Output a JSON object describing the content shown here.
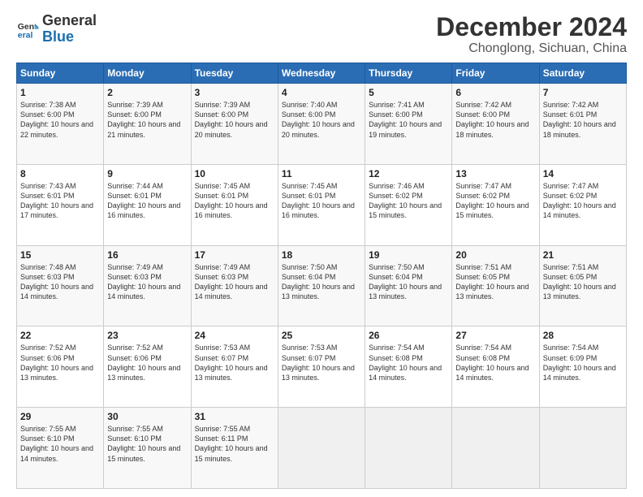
{
  "logo": {
    "text_general": "General",
    "text_blue": "Blue"
  },
  "header": {
    "month": "December 2024",
    "location": "Chonglong, Sichuan, China"
  },
  "days_of_week": [
    "Sunday",
    "Monday",
    "Tuesday",
    "Wednesday",
    "Thursday",
    "Friday",
    "Saturday"
  ],
  "weeks": [
    [
      {
        "day": "1",
        "sunrise": "Sunrise: 7:38 AM",
        "sunset": "Sunset: 6:00 PM",
        "daylight": "Daylight: 10 hours and 22 minutes."
      },
      {
        "day": "2",
        "sunrise": "Sunrise: 7:39 AM",
        "sunset": "Sunset: 6:00 PM",
        "daylight": "Daylight: 10 hours and 21 minutes."
      },
      {
        "day": "3",
        "sunrise": "Sunrise: 7:39 AM",
        "sunset": "Sunset: 6:00 PM",
        "daylight": "Daylight: 10 hours and 20 minutes."
      },
      {
        "day": "4",
        "sunrise": "Sunrise: 7:40 AM",
        "sunset": "Sunset: 6:00 PM",
        "daylight": "Daylight: 10 hours and 20 minutes."
      },
      {
        "day": "5",
        "sunrise": "Sunrise: 7:41 AM",
        "sunset": "Sunset: 6:00 PM",
        "daylight": "Daylight: 10 hours and 19 minutes."
      },
      {
        "day": "6",
        "sunrise": "Sunrise: 7:42 AM",
        "sunset": "Sunset: 6:00 PM",
        "daylight": "Daylight: 10 hours and 18 minutes."
      },
      {
        "day": "7",
        "sunrise": "Sunrise: 7:42 AM",
        "sunset": "Sunset: 6:01 PM",
        "daylight": "Daylight: 10 hours and 18 minutes."
      }
    ],
    [
      {
        "day": "8",
        "sunrise": "Sunrise: 7:43 AM",
        "sunset": "Sunset: 6:01 PM",
        "daylight": "Daylight: 10 hours and 17 minutes."
      },
      {
        "day": "9",
        "sunrise": "Sunrise: 7:44 AM",
        "sunset": "Sunset: 6:01 PM",
        "daylight": "Daylight: 10 hours and 16 minutes."
      },
      {
        "day": "10",
        "sunrise": "Sunrise: 7:45 AM",
        "sunset": "Sunset: 6:01 PM",
        "daylight": "Daylight: 10 hours and 16 minutes."
      },
      {
        "day": "11",
        "sunrise": "Sunrise: 7:45 AM",
        "sunset": "Sunset: 6:01 PM",
        "daylight": "Daylight: 10 hours and 16 minutes."
      },
      {
        "day": "12",
        "sunrise": "Sunrise: 7:46 AM",
        "sunset": "Sunset: 6:02 PM",
        "daylight": "Daylight: 10 hours and 15 minutes."
      },
      {
        "day": "13",
        "sunrise": "Sunrise: 7:47 AM",
        "sunset": "Sunset: 6:02 PM",
        "daylight": "Daylight: 10 hours and 15 minutes."
      },
      {
        "day": "14",
        "sunrise": "Sunrise: 7:47 AM",
        "sunset": "Sunset: 6:02 PM",
        "daylight": "Daylight: 10 hours and 14 minutes."
      }
    ],
    [
      {
        "day": "15",
        "sunrise": "Sunrise: 7:48 AM",
        "sunset": "Sunset: 6:03 PM",
        "daylight": "Daylight: 10 hours and 14 minutes."
      },
      {
        "day": "16",
        "sunrise": "Sunrise: 7:49 AM",
        "sunset": "Sunset: 6:03 PM",
        "daylight": "Daylight: 10 hours and 14 minutes."
      },
      {
        "day": "17",
        "sunrise": "Sunrise: 7:49 AM",
        "sunset": "Sunset: 6:03 PM",
        "daylight": "Daylight: 10 hours and 14 minutes."
      },
      {
        "day": "18",
        "sunrise": "Sunrise: 7:50 AM",
        "sunset": "Sunset: 6:04 PM",
        "daylight": "Daylight: 10 hours and 13 minutes."
      },
      {
        "day": "19",
        "sunrise": "Sunrise: 7:50 AM",
        "sunset": "Sunset: 6:04 PM",
        "daylight": "Daylight: 10 hours and 13 minutes."
      },
      {
        "day": "20",
        "sunrise": "Sunrise: 7:51 AM",
        "sunset": "Sunset: 6:05 PM",
        "daylight": "Daylight: 10 hours and 13 minutes."
      },
      {
        "day": "21",
        "sunrise": "Sunrise: 7:51 AM",
        "sunset": "Sunset: 6:05 PM",
        "daylight": "Daylight: 10 hours and 13 minutes."
      }
    ],
    [
      {
        "day": "22",
        "sunrise": "Sunrise: 7:52 AM",
        "sunset": "Sunset: 6:06 PM",
        "daylight": "Daylight: 10 hours and 13 minutes."
      },
      {
        "day": "23",
        "sunrise": "Sunrise: 7:52 AM",
        "sunset": "Sunset: 6:06 PM",
        "daylight": "Daylight: 10 hours and 13 minutes."
      },
      {
        "day": "24",
        "sunrise": "Sunrise: 7:53 AM",
        "sunset": "Sunset: 6:07 PM",
        "daylight": "Daylight: 10 hours and 13 minutes."
      },
      {
        "day": "25",
        "sunrise": "Sunrise: 7:53 AM",
        "sunset": "Sunset: 6:07 PM",
        "daylight": "Daylight: 10 hours and 13 minutes."
      },
      {
        "day": "26",
        "sunrise": "Sunrise: 7:54 AM",
        "sunset": "Sunset: 6:08 PM",
        "daylight": "Daylight: 10 hours and 14 minutes."
      },
      {
        "day": "27",
        "sunrise": "Sunrise: 7:54 AM",
        "sunset": "Sunset: 6:08 PM",
        "daylight": "Daylight: 10 hours and 14 minutes."
      },
      {
        "day": "28",
        "sunrise": "Sunrise: 7:54 AM",
        "sunset": "Sunset: 6:09 PM",
        "daylight": "Daylight: 10 hours and 14 minutes."
      }
    ],
    [
      {
        "day": "29",
        "sunrise": "Sunrise: 7:55 AM",
        "sunset": "Sunset: 6:10 PM",
        "daylight": "Daylight: 10 hours and 14 minutes."
      },
      {
        "day": "30",
        "sunrise": "Sunrise: 7:55 AM",
        "sunset": "Sunset: 6:10 PM",
        "daylight": "Daylight: 10 hours and 15 minutes."
      },
      {
        "day": "31",
        "sunrise": "Sunrise: 7:55 AM",
        "sunset": "Sunset: 6:11 PM",
        "daylight": "Daylight: 10 hours and 15 minutes."
      },
      null,
      null,
      null,
      null
    ]
  ]
}
